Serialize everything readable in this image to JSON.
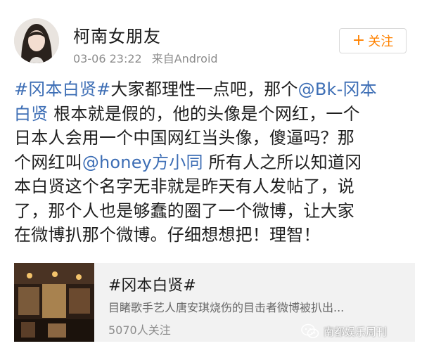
{
  "post": {
    "username": "柯南女朋友",
    "timestamp": "03-06 23:22",
    "source": "来自Android",
    "follow_label": "关注",
    "follow_plus": "+",
    "lines": [
      [
        {
          "t": "#冈本白贤#",
          "link": true
        },
        {
          "t": "大家都理性一点吧，那个",
          "link": false
        },
        {
          "t": "@Bk-冈本",
          "link": true
        }
      ],
      [
        {
          "t": "白贤",
          "link": true
        },
        {
          "t": " 根本就是假的，他的头像是个网红，一个",
          "link": false
        }
      ],
      [
        {
          "t": "日本人会用一个中国网红当头像，傻逼吗？那",
          "link": false
        }
      ],
      [
        {
          "t": "个网红叫",
          "link": false
        },
        {
          "t": "@honey方小同",
          "link": true
        },
        {
          "t": " 所有人之所以知道冈",
          "link": false
        }
      ],
      [
        {
          "t": "本白贤这个名字无非就是昨天有人发帖了，说",
          "link": false
        }
      ],
      [
        {
          "t": "了，那个人也是够蠢的圈了一个微博，让大家",
          "link": false
        }
      ],
      [
        {
          "t": "在微博扒那个微博。仔细想想把！理智！",
          "link": false
        }
      ]
    ]
  },
  "card": {
    "title": "#冈本白贤#",
    "description": "目睹歌手艺人唐安琪烧伤的目击者微博被扒出...",
    "followers": "5070人关注"
  },
  "watermark": {
    "text": "南都娱乐周刊"
  },
  "colors": {
    "link": "#3d6eb5",
    "follow_accent": "#ff8200",
    "meta_gray": "#8c8c8c",
    "card_bg": "#f2f2f2"
  }
}
